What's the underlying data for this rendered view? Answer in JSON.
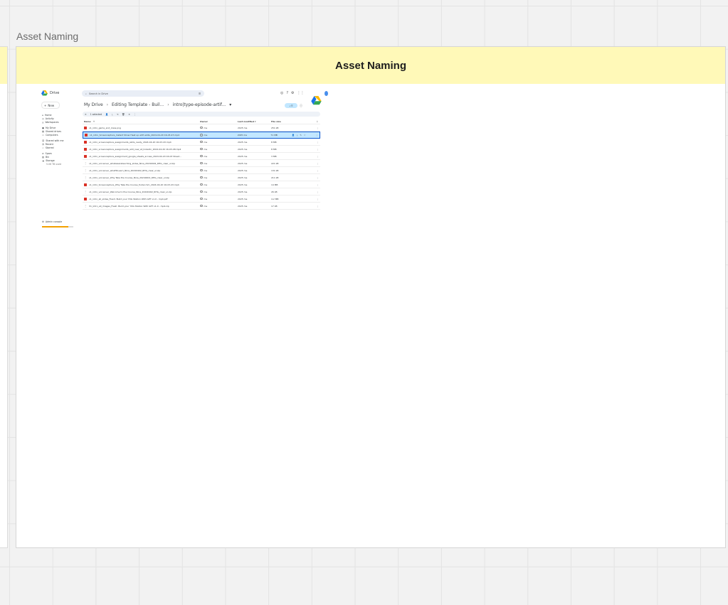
{
  "board": {
    "frame_label": "Asset Naming",
    "frame_header": "Asset Naming"
  },
  "drive": {
    "app_name": "Drive",
    "search_placeholder": "Search in Drive",
    "new_label": "New",
    "nav": {
      "home": "Home",
      "activity": "Activity",
      "workspaces": "Workspaces",
      "my_drive": "My Drive",
      "shared_drives": "Shared drives",
      "computers": "Computers",
      "shared_with_me": "Shared with me",
      "recent": "Recent",
      "starred": "Starred",
      "spam": "Spam",
      "bin": "Bin",
      "storage": "Storage",
      "storage_used": "5.06 TB used"
    },
    "admin_label": "Admin console",
    "storage_fraction": 0.85,
    "breadcrumb": [
      "My Drive",
      "Editing Template - Buil...",
      "intro|type-episode-artif..."
    ],
    "selection_label": "1 selected",
    "columns": {
      "name": "Name",
      "owner": "Owner",
      "modified": "Last modified",
      "size": "File size"
    },
    "files": [
      {
        "name": "v1_intro_game_and_class.png",
        "type": "png",
        "owner": "me",
        "modified": "2025 me",
        "size": "251 kB"
      },
      {
        "name": "v1_intro_Screencapture_Instant Show Heat up with skills_2024-04-20 16-03-47.mp4",
        "type": "video",
        "owner": "me",
        "modified": "2025 me",
        "size": "71 MB",
        "selected": true
      },
      {
        "name": "v1_intro_screencapture_assignments_skills_ready_2024-04-20 16-03-43.mp4",
        "type": "video",
        "owner": "me",
        "modified": "2025 me",
        "size": "8 MB"
      },
      {
        "name": "v1_intro_screencapture_assignments_add_new_at_linkedin_2024-04-20 16-03-48.mp4",
        "type": "video",
        "owner": "me",
        "modified": "2025 me",
        "size": "8 MB"
      },
      {
        "name": "v1_intro_screencapture_assignment_google_sheets_access_2024-04-20 16-03 Sheet...",
        "type": "video",
        "owner": "me",
        "modified": "2025 me",
        "size": "3 MB"
      },
      {
        "name": "v1_intro_voiceover_whatweareteaching_slides_Nina_20240402_RHG_clear_ul.zip",
        "type": "zip",
        "owner": "me",
        "modified": "2025 me",
        "size": "221 kB"
      },
      {
        "name": "v1_intro_voiceover_whatToLearn_Nina_20240402_RHG_clear_ul.zip",
        "type": "zip",
        "owner": "me",
        "modified": "2025 me",
        "size": "131 kB"
      },
      {
        "name": "v1_intro_voiceover_Why Take the Course_Nina_20240402_RHG_clear_ul.zip",
        "type": "zip",
        "owner": "me",
        "modified": "2025 me",
        "size": "211 kB"
      },
      {
        "name": "v1_intro_Screencapture_Why Take the Course_footer.mm_2024-04-20 16-03-43.mp4",
        "type": "video",
        "owner": "me",
        "modified": "2025 me",
        "size": "14 MB"
      },
      {
        "name": "v1_intro_voiceover_Welcome to the Course_Nina_20240402_RHG_clear_ul.zip",
        "type": "zip",
        "owner": "me",
        "modified": "2025 me",
        "size": "26 kB"
      },
      {
        "name": "v1_intro_all_slides_Fresh: Build your YOG Station With GPT v1.0 - mp4.pdf",
        "type": "pdf",
        "owner": "me",
        "modified": "2025 me",
        "size": "4.2 MB"
      },
      {
        "name": "V1_Intro_all_images_Fresh: Build your YOG Station With GPT v1.0 - mp4.zip",
        "type": "zip",
        "owner": "me",
        "modified": "2025 me",
        "size": "17 kB"
      }
    ]
  }
}
